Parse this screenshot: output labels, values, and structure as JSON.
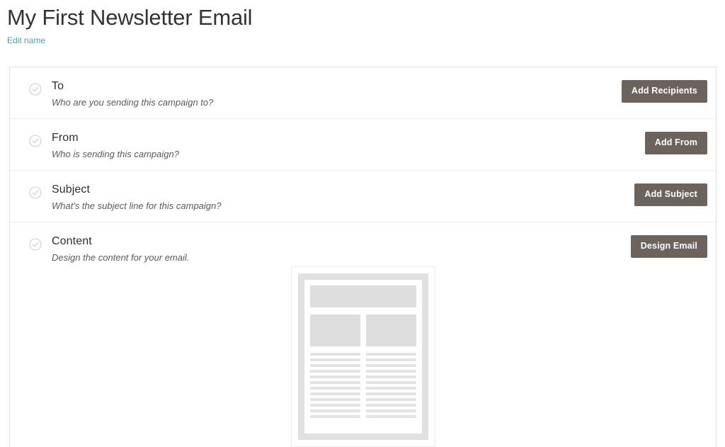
{
  "header": {
    "title": "My First Newsletter Email",
    "edit_link": "Edit name"
  },
  "checklist": {
    "check_icon": "check-circle-icon",
    "rows": [
      {
        "id": "to",
        "title": "To",
        "subtitle": "Who are you sending this campaign to?",
        "button": "Add Recipients"
      },
      {
        "id": "from",
        "title": "From",
        "subtitle": "Who is sending this campaign?",
        "button": "Add From"
      },
      {
        "id": "subject",
        "title": "Subject",
        "subtitle": "What's the subject line for this campaign?",
        "button": "Add Subject"
      },
      {
        "id": "content",
        "title": "Content",
        "subtitle": "Design the content for your email.",
        "button": "Design Email"
      }
    ]
  },
  "preview": {
    "name": "email-template-thumbnail",
    "text_lines_per_column": 12
  },
  "colors": {
    "accent_link": "#4ba3ab",
    "button_bg": "#6b635c",
    "check_icon": "#cccccc",
    "card_border": "#e0e0e0",
    "row_divider": "#ededed",
    "placeholder_block": "#dedede"
  }
}
